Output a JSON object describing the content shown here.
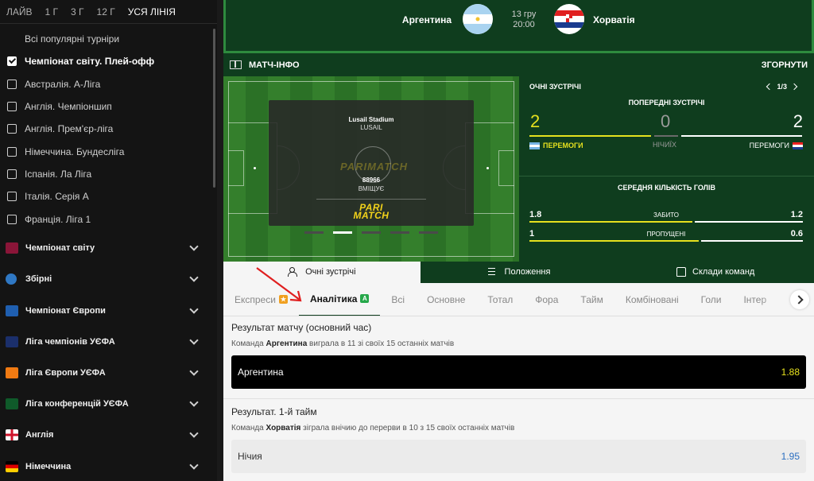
{
  "sidebar": {
    "time_tabs": [
      "ЛАЙВ",
      "1 Г",
      "3 Г",
      "12 Г",
      "УСЯ ЛІНІЯ"
    ],
    "active_time_tab": "УСЯ ЛІНІЯ",
    "tournaments": [
      {
        "label": "Всі популярні турніри",
        "checkbox": false
      },
      {
        "label": "Чемпіонат світу. Плей-офф",
        "checkbox": true,
        "checked": true
      },
      {
        "label": "Австралія. А-Ліга",
        "checkbox": true,
        "checked": false
      },
      {
        "label": "Англія. Чемпіоншип",
        "checkbox": true,
        "checked": false
      },
      {
        "label": "Англія. Прем'єр-ліга",
        "checkbox": true,
        "checked": false
      },
      {
        "label": "Німеччина. Бундесліга",
        "checkbox": true,
        "checked": false
      },
      {
        "label": "Іспанія. Ла Ліга",
        "checkbox": true,
        "checked": false
      },
      {
        "label": "Італія. Серія А",
        "checkbox": true,
        "checked": false
      },
      {
        "label": "Франція. Ліга 1",
        "checkbox": true,
        "checked": false
      }
    ],
    "categories": [
      {
        "label": "Чемпіонат світу",
        "icon": "world-cup-icon",
        "color": "#8a1538"
      },
      {
        "label": "Збірні",
        "icon": "globe-icon",
        "color": "#2f78c4"
      },
      {
        "label": "Чемпіонат Європи",
        "icon": "euro-trophy-icon",
        "color": "#1f5fb0"
      },
      {
        "label": "Ліга чемпіонів УЄФА",
        "icon": "champions-league-icon",
        "color": "#1b2f6b"
      },
      {
        "label": "Ліга Європи УЄФА",
        "icon": "europa-league-icon",
        "color": "#f07a12"
      },
      {
        "label": "Ліга конференцій УЄФА",
        "icon": "conference-league-icon",
        "color": "#0f5a2a"
      },
      {
        "label": "Англія",
        "icon": "england-flag-icon",
        "color": "#ffffff"
      },
      {
        "label": "Німеччина",
        "icon": "germany-flag-icon",
        "color": "#000000"
      }
    ]
  },
  "match": {
    "team_home": "Аргентина",
    "team_away": "Хорватія",
    "date": "13 гру",
    "time": "20:00"
  },
  "info_bar": {
    "title": "МАТЧ-ІНФО",
    "collapse_label": "ЗГОРНУТИ"
  },
  "stadium": {
    "name": "Lusail Stadium",
    "city": "LUSAIL",
    "capacity": "88966",
    "capacity_label": "ВМІЩУЄ",
    "logo_line1": "PARI",
    "logo_line2": "MATCH",
    "watermark": "PARIMATCH",
    "carousel_count": 5,
    "carousel_active": 2
  },
  "h2h": {
    "title": "ОЧНІ ЗУСТРІЧІ",
    "pager": "1/3",
    "prev_title": "ПОПЕРЕДНІ ЗУСТРІЧІ",
    "home_wins": "2",
    "draws": "0",
    "away_wins": "2",
    "home_wins_label": "ПЕРЕМОГИ",
    "draws_label": "НІЧИЇХ",
    "away_wins_label": "ПЕРЕМОГИ",
    "avg_title": "СЕРЕДНЯ КІЛЬКІСТЬ ГОЛІВ",
    "scored": {
      "label": "ЗАБИТО",
      "home": "1.8",
      "away": "1.2"
    },
    "conceded": {
      "label": "ПРОПУЩЕНІ",
      "home": "1",
      "away": "0.6"
    }
  },
  "big_tabs": [
    {
      "label": "Очні зустрічі",
      "icon": "people-icon",
      "active": true
    },
    {
      "label": "Положення",
      "icon": "standings-icon",
      "active": false
    },
    {
      "label": "Склади команд",
      "icon": "shirt-icon",
      "active": false
    }
  ],
  "market_tabs": [
    {
      "label": "Експреси",
      "badge": "★",
      "badge_color": "orange"
    },
    {
      "label": "Аналітика",
      "badge": "A",
      "badge_color": "green",
      "active": true
    },
    {
      "label": "Всі"
    },
    {
      "label": "Основне"
    },
    {
      "label": "Тотал"
    },
    {
      "label": "Фора"
    },
    {
      "label": "Тайм"
    },
    {
      "label": "Комбіновані"
    },
    {
      "label": "Голи"
    },
    {
      "label": "Інтер"
    }
  ],
  "bets": [
    {
      "title": "Результат матчу (основний час)",
      "sub_prefix": "Команда ",
      "sub_team": "Аргентина",
      "sub_suffix": " виграла в 11 зі своїх 15 останніх матчів",
      "pick": "Аргентина",
      "odd": "1.88",
      "style": "dark"
    },
    {
      "title": "Результат. 1-й тайм",
      "sub_prefix": "Команда ",
      "sub_team": "Хорватія",
      "sub_suffix": " зіграла внічию до перерви в 10 з 15 своїх останніх матчів",
      "pick": "Нічия",
      "odd": "1.95",
      "style": "light"
    }
  ]
}
